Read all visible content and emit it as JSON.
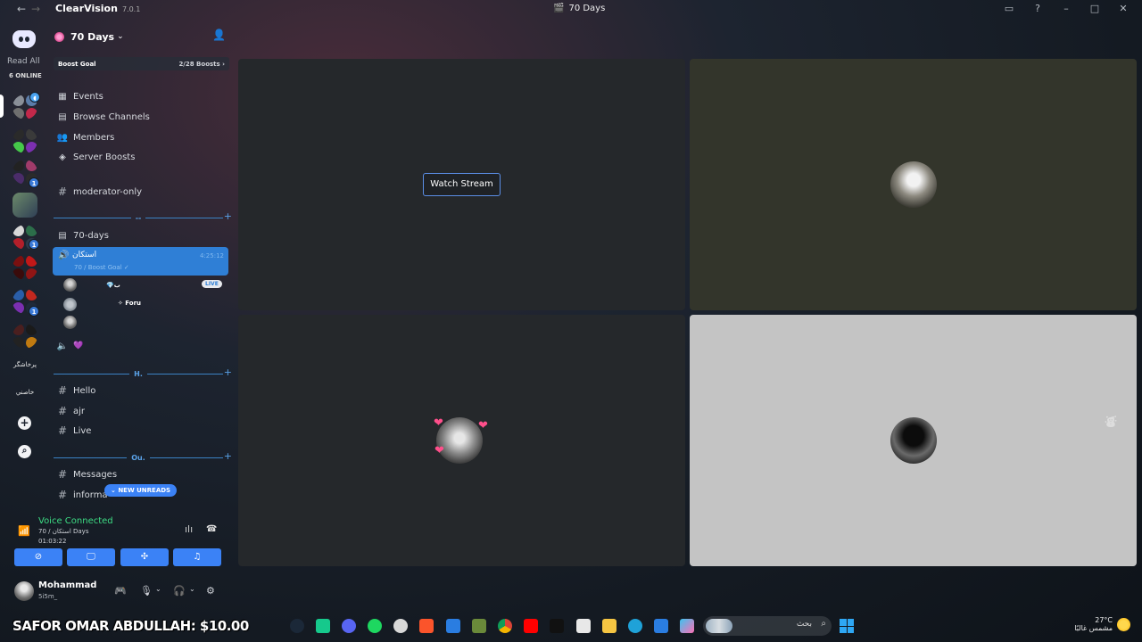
{
  "titlebar": {
    "back": "←",
    "forward": "→",
    "app_name": "ClearVision",
    "version": "7.0.1",
    "window_title": "70 Days",
    "window_title_icon": "🎬"
  },
  "guilds": {
    "read_all": "Read All",
    "online_count": "6 ONLINE",
    "badge_1": "1",
    "badge_2": "1",
    "badge_3": "1",
    "text_guild_1": "پرخاشگر",
    "text_guild_2": "خاصني",
    "add_server": "+",
    "discover": "⌕"
  },
  "server": {
    "name": "70 Days",
    "boost_goal": "Boost Goal",
    "boost_count": "2/28 Boosts ›"
  },
  "nav": {
    "events": "Events",
    "browse_channels": "Browse Channels",
    "members": "Members",
    "server_boosts": "Server Boosts"
  },
  "channels": {
    "moderator_only": "moderator-only",
    "divider_1": "--",
    "seventy_days": "70-days",
    "voice_name": "استكان",
    "voice_time": "4:25:12",
    "voice_sub": "70 / Boost Goal ✓",
    "user_tag_1": "💎ب",
    "live": "LIVE",
    "user_tag_2": "✧ Foru",
    "voice2_icon": "💜",
    "divider_2": "H.",
    "hello": "Hello",
    "ajr": "ajr",
    "live_channel": "Live",
    "divider_3": "Ou.",
    "messages": "Messages",
    "information": "informa",
    "new_unreads": "NEW UNREADS"
  },
  "voice_panel": {
    "title": "Voice Connected",
    "subtitle": "70 / استكان Days",
    "timer": "01:03:22"
  },
  "user": {
    "name": "Mohammad",
    "status": "5i5m_"
  },
  "stage": {
    "watch_stream": "Watch Stream"
  },
  "taskbar": {
    "donation": "SAFOR OMAR ABDULLAH: $10.00",
    "search_placeholder": "بحث",
    "temperature": "27°C",
    "weather": "مشمس غالبًا"
  },
  "colors": {
    "accent": "#3b82f6",
    "voice_green": "#3ddc84",
    "tile_dark": "#25282b",
    "tile_olive": "#33352b",
    "tile_light": "#c4c4c4"
  }
}
